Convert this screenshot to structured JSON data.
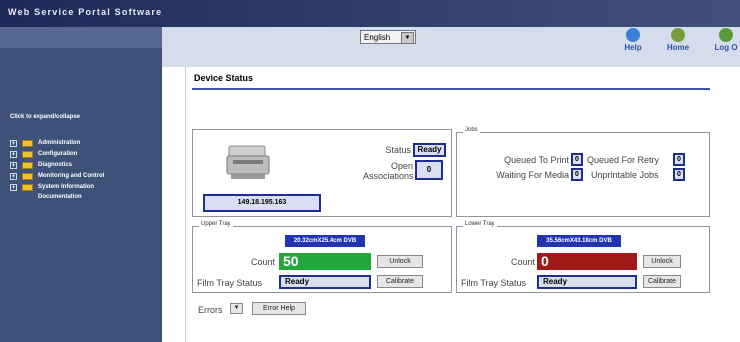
{
  "header": {
    "brand": "Web Service Portal Software",
    "language": "English",
    "nav": [
      {
        "label": "Help",
        "icon": "help-icon",
        "color": "#3b7fd6"
      },
      {
        "label": "Home",
        "icon": "home-icon",
        "color": "#7b9b3a"
      },
      {
        "label": "Log O",
        "icon": "logout-icon",
        "color": "#5a9a3a"
      }
    ]
  },
  "sidebar": {
    "hint": "Click to expand/collapse",
    "items": [
      {
        "label": "Administration"
      },
      {
        "label": "Configuration"
      },
      {
        "label": "Diagnostics"
      },
      {
        "label": "Monitoring and Control"
      },
      {
        "label": "System Information"
      }
    ],
    "extra": "Documentation"
  },
  "main": {
    "title": "Device Status",
    "device": {
      "ip": "149.18.195.163",
      "status_label": "Status",
      "status_value": "Ready",
      "open_label": "Open Associations",
      "open_value": "0"
    },
    "jobs": {
      "legend": "Jobs",
      "queued_label": "Queued To Print",
      "queued_value": "0",
      "retry_label": "Queued For Retry",
      "retry_value": "0",
      "waiting_label": "Waiting For Media",
      "waiting_value": "0",
      "unprint_label": "Unprintable Jobs",
      "unprint_value": "0"
    },
    "upper": {
      "legend": "Upper Tray",
      "dims": "20.32cmX25.4cm DVB",
      "count_label": "Count",
      "count": "50",
      "status_label": "Film Tray Status",
      "status": "Ready",
      "unlock": "Unlock",
      "calibrate": "Calibrate",
      "color": "#22a83a"
    },
    "lower": {
      "legend": "Lower Tray",
      "dims": "35.56cmX43.18cm DVB",
      "count_label": "Count",
      "count": "0",
      "status_label": "Film Tray Status",
      "status": "Ready",
      "unlock": "Unlock",
      "calibrate": "Calibrate",
      "color": "#a01a1a"
    },
    "errors": {
      "label": "Errors",
      "help": "Error Help"
    }
  }
}
